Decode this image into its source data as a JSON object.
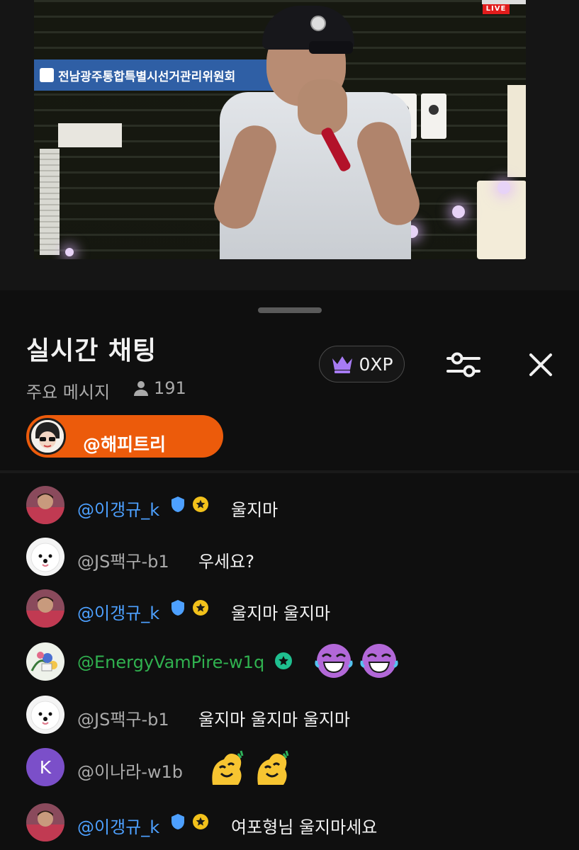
{
  "video": {
    "banner_text": "전남광주통합특별시선거관리위원회",
    "live_label": "LIVE"
  },
  "chat": {
    "title": "실시간 채팅",
    "mode_label": "주요 메시지",
    "viewer_count": "191",
    "xp_label": "0XP",
    "pinned_user": "@해피트리",
    "icons": {
      "viewers": "person-icon",
      "xp": "crown-icon",
      "filter": "sliders-icon",
      "close": "close-icon"
    },
    "colors": {
      "moderator": "#4da0ff",
      "member": "#30b14f",
      "pinned_bg": "#ec5b0b",
      "crown": "#a77bf3"
    },
    "messages": [
      {
        "author": "@이갱규_k",
        "role": "moderator",
        "badges": [
          "shield",
          "star"
        ],
        "text": "울지마"
      },
      {
        "author": "@JS팩구-b1",
        "role": "normal",
        "badges": [],
        "text": "우세요?"
      },
      {
        "author": "@이갱규_k",
        "role": "moderator",
        "badges": [
          "shield",
          "star"
        ],
        "text": "울지마 울지마"
      },
      {
        "author": "@EnergyVamPire-w1q",
        "role": "member",
        "badges": [
          "member-star"
        ],
        "text": "",
        "emoji": [
          "crying-laugh-emoji",
          "crying-laugh-emoji"
        ]
      },
      {
        "author": "@JS팩구-b1",
        "role": "normal",
        "badges": [],
        "text": "울지마 울지마 울지마"
      },
      {
        "author": "@이나라-w1b",
        "role": "normal",
        "badges": [],
        "avatar_letter": "K",
        "text": "",
        "emoji": [
          "happy-blob-emoji",
          "happy-blob-emoji"
        ]
      },
      {
        "author": "@이갱규_k",
        "role": "moderator",
        "badges": [
          "shield",
          "star"
        ],
        "text": "여포형님 울지마세요"
      }
    ]
  }
}
